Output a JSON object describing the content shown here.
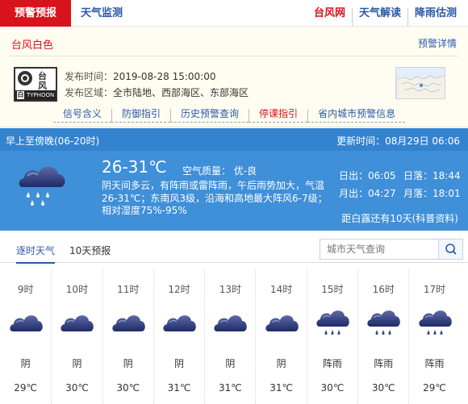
{
  "nav": {
    "active_tab": "预警预报",
    "weather_tab": "天气监测",
    "links": [
      {
        "label": "台风网",
        "color": "#d8131b"
      },
      {
        "label": "天气解读",
        "color": "#2b5aa7"
      },
      {
        "label": "降雨估测",
        "color": "#2b5aa7"
      }
    ]
  },
  "warning": {
    "title": "台风白色",
    "detail_link": "预警详情",
    "icon": {
      "char1": "台",
      "char2": "风",
      "level": "白",
      "en": "TYPHOON"
    },
    "time_label": "发布时间：",
    "time_value": "2019-08-28 15:00:00",
    "area_label": "发布区域：",
    "area_value": "全市陆地、西部海区、东部海区",
    "links": [
      {
        "label": "信号含义",
        "red": false
      },
      {
        "label": "防御指引",
        "red": false
      },
      {
        "label": "历史预警查询",
        "red": false
      },
      {
        "label": "停课指引",
        "red": true
      },
      {
        "label": "省内城市预警信息",
        "red": false
      }
    ]
  },
  "now": {
    "period": "早上至傍晚(06-20时)",
    "update": "更新时间：08月29日 06:06",
    "temp": "26-31℃",
    "air_quality": "空气质量：  优-良",
    "desc": "阴天间多云，有阵雨或雷阵雨，午后雨势加大，气温26-31℃；东南风3级，沿海和高地最大阵风6-7级；相对湿度75%-95%",
    "sunrise": "日出：06:05",
    "sunset": "日落：18:44",
    "moonrise": "月出：04:27",
    "moonset": "月落：18:01",
    "reminder": "距白露还有10天(科普资料)"
  },
  "tabs": {
    "hourly": "逐时天气",
    "ten_day": "10天预报"
  },
  "search": {
    "placeholder": "城市天气查询"
  },
  "hourly": [
    {
      "hour": "9时",
      "weather": "阴",
      "temp": "29℃",
      "icon": "cloudy-icon"
    },
    {
      "hour": "10时",
      "weather": "阴",
      "temp": "30℃",
      "icon": "cloudy-icon"
    },
    {
      "hour": "11时",
      "weather": "阴",
      "temp": "30℃",
      "icon": "cloudy-icon"
    },
    {
      "hour": "12时",
      "weather": "阴",
      "temp": "31℃",
      "icon": "cloudy-icon"
    },
    {
      "hour": "13时",
      "weather": "阴",
      "temp": "31℃",
      "icon": "cloudy-icon"
    },
    {
      "hour": "14时",
      "weather": "阴",
      "temp": "31℃",
      "icon": "cloudy-icon"
    },
    {
      "hour": "15时",
      "weather": "阵雨",
      "temp": "30℃",
      "icon": "shower-icon"
    },
    {
      "hour": "16时",
      "weather": "阵雨",
      "temp": "30℃",
      "icon": "shower-icon"
    },
    {
      "hour": "17时",
      "weather": "阵雨",
      "temp": "29℃",
      "icon": "shower-icon"
    }
  ]
}
